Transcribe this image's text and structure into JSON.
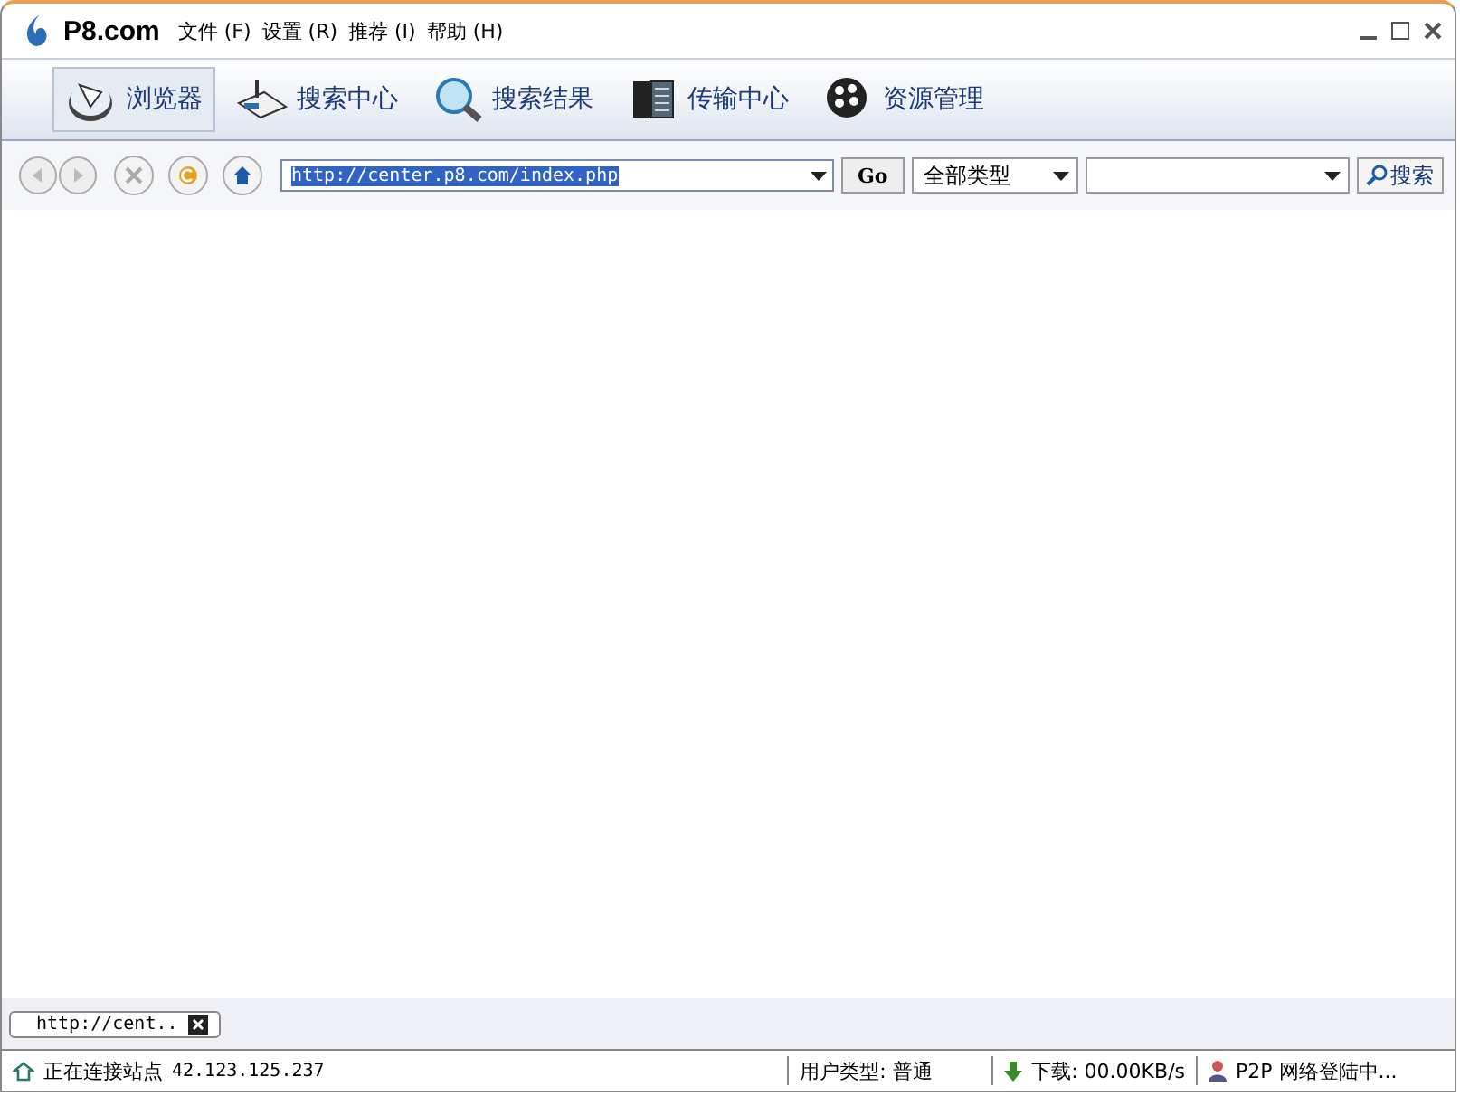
{
  "window": {
    "logo": "P8.com",
    "menu": [
      "文件 (F)",
      "设置 (R)",
      "推荐 (I)",
      "帮助 (H)"
    ]
  },
  "tabs": [
    {
      "label": "浏览器",
      "kind": "browser",
      "selected": true
    },
    {
      "label": "搜索中心",
      "kind": "search",
      "selected": false
    },
    {
      "label": "搜索结果",
      "kind": "results",
      "selected": false
    },
    {
      "label": "传输中心",
      "kind": "transfer",
      "selected": false
    },
    {
      "label": "资源管理",
      "kind": "resources",
      "selected": false
    }
  ],
  "address_bar": {
    "url": "http://center.p8.com/index.php",
    "go": "Go",
    "type": "全部类型",
    "search_button": "搜索"
  },
  "page_tabs": [
    {
      "label": "http://cent.."
    }
  ],
  "status_bar": {
    "connection": "正在连接站点",
    "ip": "42.123.125.237",
    "user_type": "用户类型: 普通",
    "download": "下载: 00.00KB/s",
    "p2p": "P2P 网络登陆中..."
  }
}
